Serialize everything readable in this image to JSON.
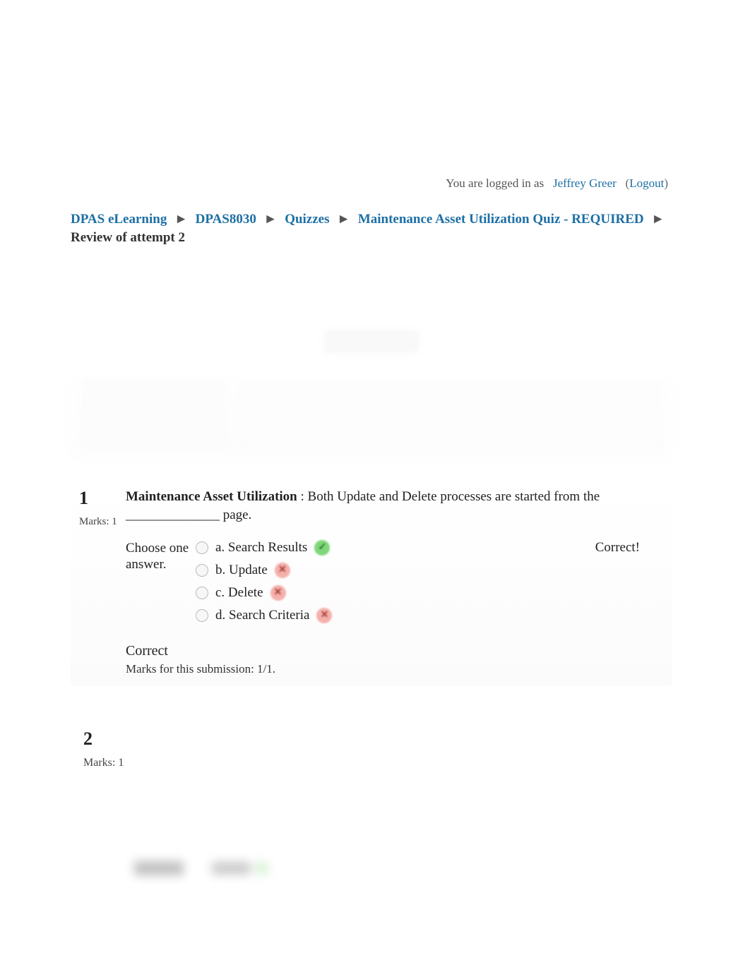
{
  "login": {
    "prefix": "You are logged in as",
    "user": "Jeffrey Greer",
    "logout": "Logout"
  },
  "breadcrumb": {
    "items": [
      "DPAS eLearning",
      "DPAS8030",
      "Quizzes",
      "Maintenance Asset Utilization Quiz - REQUIRED"
    ],
    "current": "Review of attempt 2",
    "sep": "►"
  },
  "q1": {
    "number": "1",
    "marks_label": "Marks: 1",
    "text_bold": "Maintenance Asset Utilization",
    "text_rest": ": Both Update and Delete processes are started from the ______________ page.",
    "choose_label": "Choose one answer.",
    "answers": [
      {
        "label": "a. Search Results",
        "correct": true
      },
      {
        "label": "b. Update",
        "correct": false
      },
      {
        "label": "c. Delete",
        "correct": false
      },
      {
        "label": "d. Search Criteria",
        "correct": false
      }
    ],
    "feedback": "Correct!",
    "result": "Correct",
    "submission_marks": "Marks for this submission: 1/1."
  },
  "q2": {
    "number": "2",
    "marks_label": "Marks: 1"
  }
}
